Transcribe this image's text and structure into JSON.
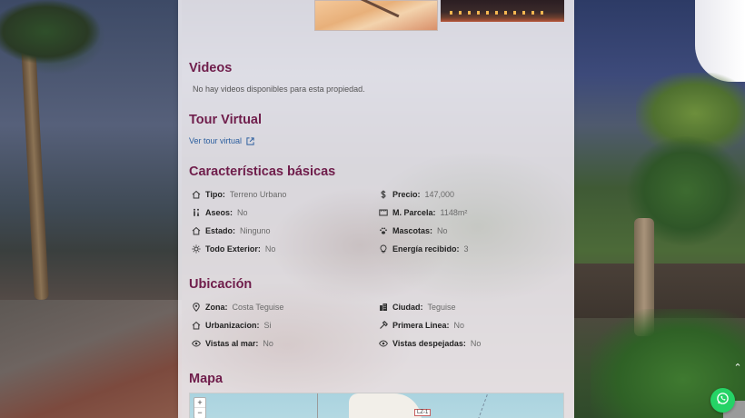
{
  "videos": {
    "title": "Videos",
    "empty_message": "No hay videos disponibles para esta propiedad."
  },
  "tour": {
    "title": "Tour Virtual",
    "link_label": "Ver tour virtual"
  },
  "basic": {
    "title": "Características básicas",
    "left": [
      {
        "icon": "home-icon",
        "label": "Tipo:",
        "value": "Terreno Urbano"
      },
      {
        "icon": "restroom-icon",
        "label": "Aseos:",
        "value": "No"
      },
      {
        "icon": "home-icon",
        "label": "Estado:",
        "value": "Ninguno"
      },
      {
        "icon": "sun-icon",
        "label": "Todo Exterior:",
        "value": "No"
      }
    ],
    "right": [
      {
        "icon": "dollar-icon",
        "label": "Precio:",
        "value": "147,000"
      },
      {
        "icon": "ruler-icon",
        "label": "M. Parcela:",
        "value": "1148m²"
      },
      {
        "icon": "paw-icon",
        "label": "Mascotas:",
        "value": "No"
      },
      {
        "icon": "bulb-icon",
        "label": "Energía recibido:",
        "value": "3"
      }
    ]
  },
  "location": {
    "title": "Ubicación",
    "left": [
      {
        "icon": "pin-icon",
        "label": "Zona:",
        "value": "Costa Teguise"
      },
      {
        "icon": "home-icon",
        "label": "Urbanizacion:",
        "value": "Si"
      },
      {
        "icon": "eye-icon",
        "label": "Vistas al mar:",
        "value": "No"
      }
    ],
    "right": [
      {
        "icon": "building-icon",
        "label": "Ciudad:",
        "value": "Teguise"
      },
      {
        "icon": "hammer-icon",
        "label": "Primera Linea:",
        "value": "No"
      },
      {
        "icon": "eye-icon",
        "label": "Vistas despejadas:",
        "value": "No"
      }
    ]
  },
  "map": {
    "title": "Mapa",
    "zoom_in": "+",
    "zoom_out": "−",
    "road_label": "LZ-1"
  },
  "floating": {
    "scroll_top": "⌃"
  },
  "colors": {
    "heading": "#6f1d4b",
    "link": "#2c5e9e",
    "whatsapp": "#25d366"
  }
}
